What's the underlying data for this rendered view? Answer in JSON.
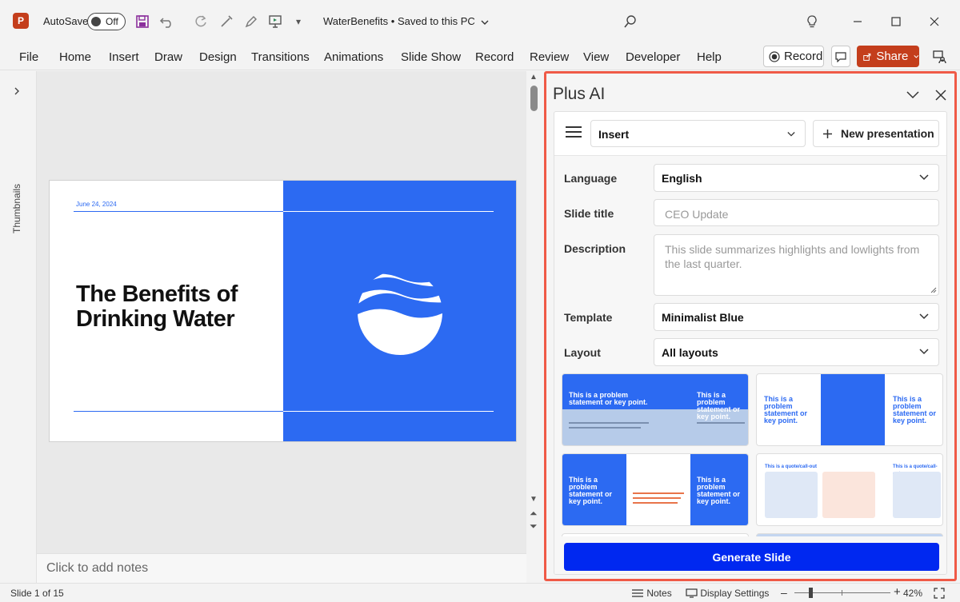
{
  "titlebar": {
    "app_icon": "powerpoint-icon",
    "autosave_label": "AutoSave",
    "autosave_state": "Off",
    "document_title": "WaterBenefits",
    "save_status": "Saved to this PC",
    "icons": [
      "save-icon",
      "undo-icon",
      "redo-icon",
      "format-painter-icon",
      "pen-icon",
      "present-icon",
      "customize-icon",
      "search-icon",
      "lightbulb-icon",
      "minimize-icon",
      "maximize-icon",
      "close-icon"
    ]
  },
  "ribbon": {
    "tabs": [
      "File",
      "Home",
      "Insert",
      "Draw",
      "Design",
      "Transitions",
      "Animations",
      "Slide Show",
      "Record",
      "Review",
      "View",
      "Developer",
      "Help"
    ],
    "record_button": "Record",
    "share_button": "Share"
  },
  "sidebar": {
    "label": "Thumbnails"
  },
  "slide": {
    "date": "June 24, 2024",
    "title_line1": "The Benefits of",
    "title_line2": "Drinking Water",
    "colors": {
      "accent": "#2c6af2",
      "background": "#ffffff"
    }
  },
  "notes": {
    "placeholder": "Click to add notes"
  },
  "plus_ai": {
    "title": "Plus AI",
    "mode_select": "Insert",
    "new_presentation": "New presentation",
    "fields": {
      "language": {
        "label": "Language",
        "value": "English"
      },
      "slide_title": {
        "label": "Slide title",
        "placeholder": "CEO Update"
      },
      "description": {
        "label": "Description",
        "placeholder": "This slide summarizes highlights and lowlights from the last quarter."
      },
      "template": {
        "label": "Template",
        "value": "Minimalist Blue"
      },
      "layout": {
        "label": "Layout",
        "value": "All layouts"
      }
    },
    "layout_thumbs": [
      {
        "text_a": "This is a problem statement or key point.",
        "text_b": "This is a problem statement or key point."
      },
      {
        "text_a": "This is a problem statement or key point.",
        "text_b": "This is a problem statement or key point."
      },
      {
        "text_a": "This is a problem statement or key point.",
        "text_b": "This is a problem statement or key point."
      },
      {
        "text_a": "This is a quote/call-out",
        "text_b": "This is a quote/call-out"
      }
    ],
    "generate_button": "Generate Slide",
    "accent": "#0028f0",
    "highlight_border": "#ef5a47"
  },
  "statusbar": {
    "slide_info": "Slide 1 of 15",
    "notes": "Notes",
    "display_settings": "Display Settings",
    "zoom": "42%"
  }
}
